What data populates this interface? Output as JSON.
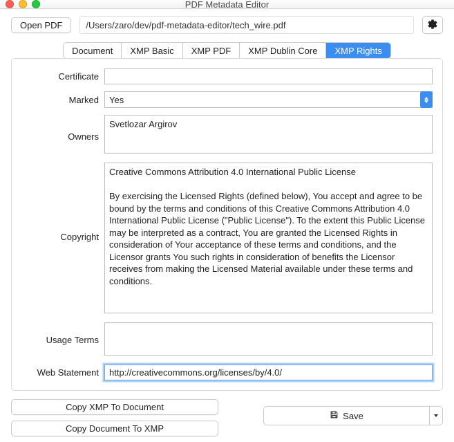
{
  "window": {
    "title": "PDF Metadata Editor"
  },
  "toolbar": {
    "open_label": "Open PDF",
    "path": "/Users/zaro/dev/pdf-metadata-editor/tech_wire.pdf"
  },
  "tabs": [
    {
      "label": "Document",
      "active": false
    },
    {
      "label": "XMP Basic",
      "active": false
    },
    {
      "label": "XMP PDF",
      "active": false
    },
    {
      "label": "XMP Dublin Core",
      "active": false
    },
    {
      "label": "XMP Rights",
      "active": true
    }
  ],
  "form": {
    "certificate": {
      "label": "Certificate",
      "value": ""
    },
    "marked": {
      "label": "Marked",
      "value": "Yes"
    },
    "owners": {
      "label": "Owners",
      "value": "Svetlozar Argirov"
    },
    "copyright": {
      "label": "Copyright",
      "value": "Creative Commons Attribution 4.0 International Public License\n\nBy exercising the Licensed Rights (defined below), You accept and agree to be bound by the terms and conditions of this Creative Commons Attribution 4.0 International Public License (\"Public License\"). To the extent this Public License may be interpreted as a contract, You are granted the Licensed Rights in consideration of Your acceptance of these terms and conditions, and the Licensor grants You such rights in consideration of benefits the Licensor receives from making the Licensed Material available under these terms and conditions."
    },
    "usage_terms": {
      "label": "Usage Terms",
      "value": ""
    },
    "web_statement": {
      "label": "Web Statement",
      "value": "http://creativecommons.org/licenses/by/4.0/"
    }
  },
  "bottom": {
    "copy_xmp_to_doc": "Copy XMP To Document",
    "copy_doc_to_xmp": "Copy Document To XMP",
    "save": "Save"
  }
}
